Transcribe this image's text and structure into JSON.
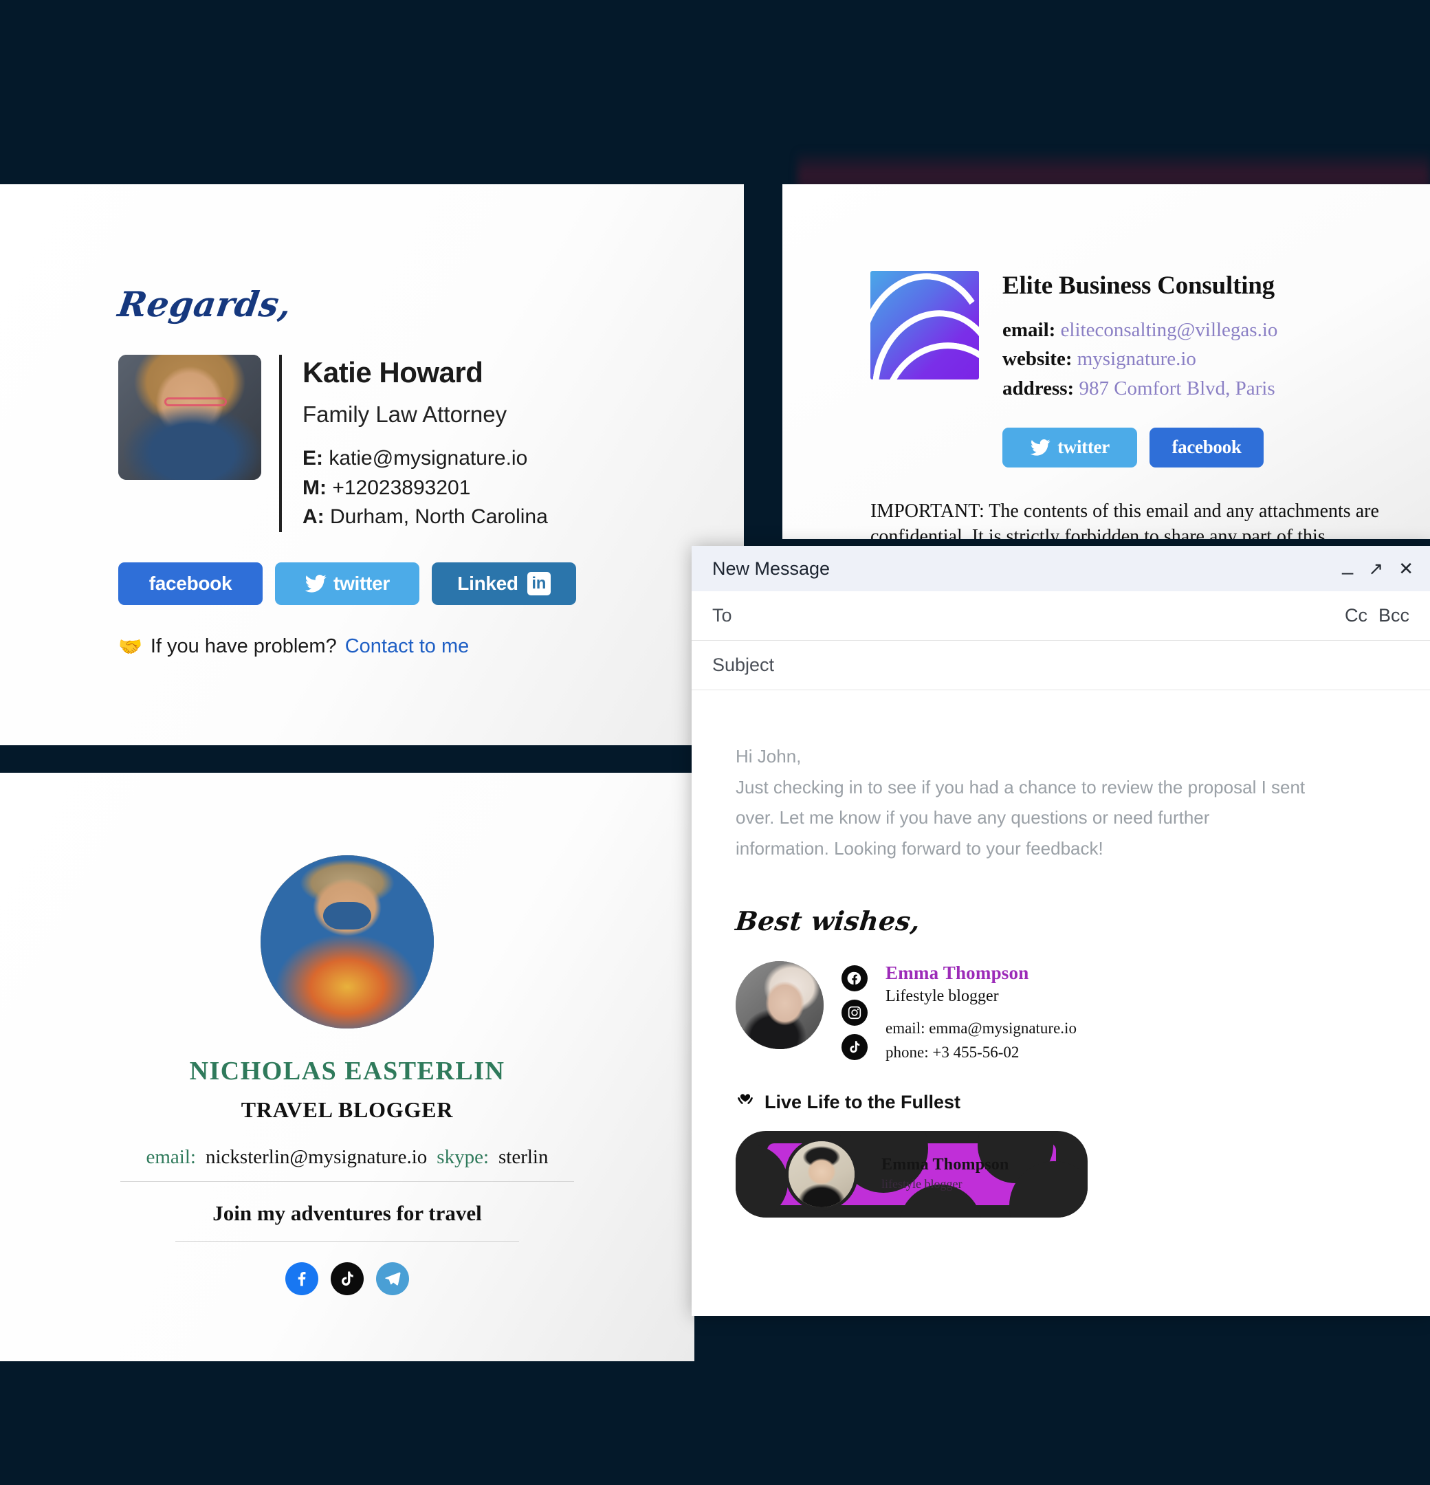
{
  "backdrop": {
    "color": "#04192a",
    "tint_color": "#561630"
  },
  "katie_card": {
    "greeting": "Regards,",
    "name": "Katie Howard",
    "role": "Family Law Attorney",
    "contacts": [
      {
        "label": "E:",
        "value": "katie@mysignature.io"
      },
      {
        "label": "M:",
        "value": "+12023893201"
      },
      {
        "label": "A:",
        "value": "Durham, North Carolina"
      }
    ],
    "social": [
      {
        "name": "facebook",
        "label": "facebook",
        "color": "#2f6fd8"
      },
      {
        "name": "twitter",
        "label": "twitter",
        "color": "#4cabe8"
      },
      {
        "name": "linkedin",
        "label": "Linked",
        "badge": "in",
        "color": "#2b75ab"
      }
    ],
    "footer_text": "If you have problem?",
    "footer_link": "Contact to me",
    "footer_icon": "handshake-icon"
  },
  "elite_card": {
    "company": "Elite Business Consulting",
    "rows": [
      {
        "label": "email:",
        "value": "eliteconsalting@villegas.io"
      },
      {
        "label": "website:",
        "value": "mysignature.io"
      },
      {
        "label": "address:",
        "value": "987 Comfort Blvd, Paris"
      }
    ],
    "social": [
      {
        "name": "twitter",
        "label": "twitter",
        "color": "#4cabe8"
      },
      {
        "name": "facebook",
        "label": "facebook",
        "color": "#2f6fd8"
      }
    ],
    "disclaimer": "IMPORTANT: The contents of this email and any attachments are confidential. It is strictly forbidden to share any part of this message with any third party, without a written consent of the"
  },
  "nicholas_card": {
    "name": "NICHOLAS EASTERLIN",
    "role": "TRAVEL BLOGGER",
    "email_label": "email:",
    "email_value": "nicksterlin@mysignature.io",
    "skype_label": "skype:",
    "skype_value": "sterlin",
    "cta": "Join my adventures for travel",
    "social": [
      {
        "name": "facebook-icon",
        "glyph": "f",
        "color": "#1877f2"
      },
      {
        "name": "tiktok-icon",
        "glyph": "♪",
        "color": "#0b0b0b"
      },
      {
        "name": "telegram-icon",
        "glyph": "➤",
        "color": "#4a9fd5"
      }
    ]
  },
  "compose": {
    "title": "New Message",
    "minimize_icon": "–",
    "expand_icon": "↗",
    "close_icon": "✕",
    "to_label": "To",
    "cc_label": "Cc",
    "bcc_label": "Bcc",
    "subject_label": "Subject",
    "body_lines": [
      "Hi John,",
      "Just checking in to see if you had a chance to review the proposal I sent over. Let me know if you have any questions or need further information. Looking forward to your feedback!"
    ],
    "signature": {
      "closing": "Best wishes,",
      "name": "Emma Thompson",
      "role": "Lifestyle blogger",
      "email": "email: emma@mysignature.io",
      "phone": "phone: +3 455-56-02",
      "icons": [
        {
          "name": "facebook-icon",
          "glyph": "f"
        },
        {
          "name": "instagram-icon",
          "glyph": "□"
        },
        {
          "name": "tiktok-icon",
          "glyph": "♪"
        }
      ],
      "tagline": "Live Life to the Fullest",
      "tagline_icon": "heart-hands-icon",
      "banner": {
        "name": "Emma Thompson",
        "subtitle": "lifestyle blogger",
        "bg_color": "#232323",
        "accent_color": "#c02fd8"
      }
    }
  }
}
